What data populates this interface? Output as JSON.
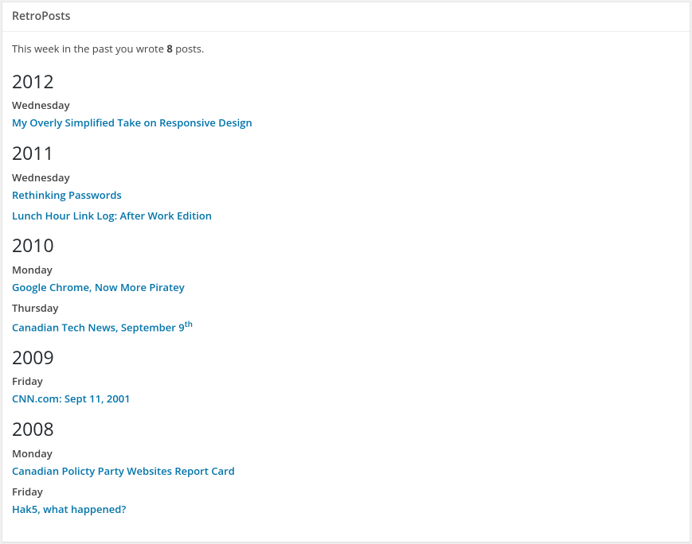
{
  "widget_title": "RetroPosts",
  "intro_prefix": "This week in the past you wrote ",
  "intro_count": "8",
  "intro_suffix": " posts.",
  "years": [
    {
      "year": "2012",
      "days": [
        {
          "day": "Wednesday",
          "posts": [
            {
              "title": "My Overly Simplified Take on Responsive Design"
            }
          ]
        }
      ]
    },
    {
      "year": "2011",
      "days": [
        {
          "day": "Wednesday",
          "posts": [
            {
              "title": "Rethinking Passwords"
            },
            {
              "title": "Lunch Hour Link Log: After Work Edition"
            }
          ]
        }
      ]
    },
    {
      "year": "2010",
      "days": [
        {
          "day": "Monday",
          "posts": [
            {
              "title": "Google Chrome, Now More Piratey"
            }
          ]
        },
        {
          "day": "Thursday",
          "posts": [
            {
              "title": "Canadian Tech News, September 9",
              "sup": "th"
            }
          ]
        }
      ]
    },
    {
      "year": "2009",
      "days": [
        {
          "day": "Friday",
          "posts": [
            {
              "title": "CNN.com: Sept 11, 2001"
            }
          ]
        }
      ]
    },
    {
      "year": "2008",
      "days": [
        {
          "day": "Monday",
          "posts": [
            {
              "title": "Canadian Policty Party Websites Report Card"
            }
          ]
        },
        {
          "day": "Friday",
          "posts": [
            {
              "title": "Hak5, what happened?"
            }
          ]
        }
      ]
    }
  ]
}
